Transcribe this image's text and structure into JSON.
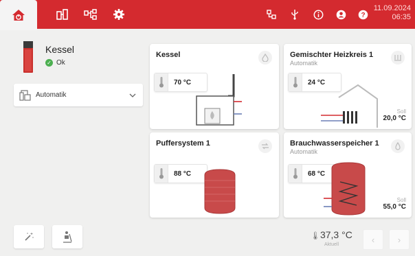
{
  "topbar": {
    "color": "#d42a2f",
    "icons": [
      "home-icon",
      "heating-system-icon",
      "network-icon",
      "settings-icon",
      "connection-icon",
      "usb-icon",
      "info-icon",
      "user-icon",
      "help-icon"
    ],
    "date": "11.09.2024",
    "time": "06:35"
  },
  "device": {
    "name": "Kessel",
    "status": "Ok",
    "status_color": "#4caf50"
  },
  "mode_select": {
    "value": "Automatik"
  },
  "cards": {
    "boiler": {
      "title": "Kessel",
      "temp": "70 °C"
    },
    "heating_circuit": {
      "title": "Gemischter Heizkreis 1",
      "subtitle": "Automatik",
      "temp": "24 °C",
      "target_label": "Soll",
      "target": "20,0 °C"
    },
    "buffer": {
      "title": "Puffersystem 1",
      "temp": "88 °C"
    },
    "hot_water": {
      "title": "Brauchwasserspeicher 1",
      "subtitle": "Automatik",
      "temp": "68 °C",
      "target_label": "Soll",
      "target": "55,0 °C"
    }
  },
  "footer": {
    "outside_temp": "37,3 °C",
    "outside_label": "Aktuell"
  }
}
